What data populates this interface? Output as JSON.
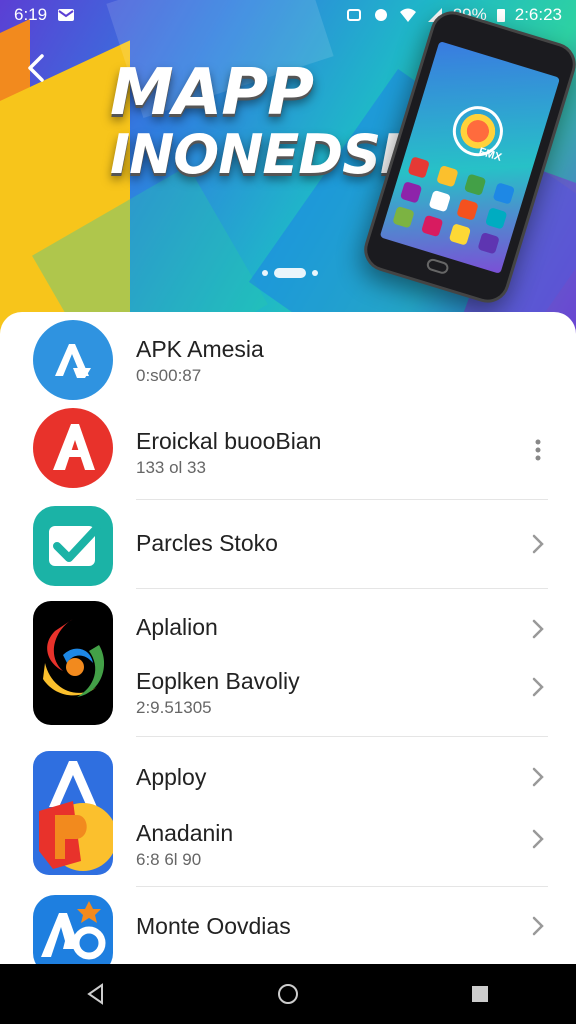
{
  "status_bar": {
    "time_left": "6:19",
    "battery": "89%",
    "time_right": "2:6:23"
  },
  "hero": {
    "title_line1": "MAPP",
    "title_line2": "INONEDSI",
    "phone_badge": "FMX"
  },
  "apps": [
    {
      "title": "APK Amesia",
      "subtitle": "0:s00:87",
      "icon": "apk-app-icon"
    },
    {
      "title": "Eroickal buooBian",
      "subtitle": "133 ol 33",
      "icon": "red-a-app-icon"
    },
    {
      "title": "Parcles Stoko",
      "subtitle": "",
      "icon": "checkmark-app-icon"
    },
    {
      "title": "Aplalion",
      "subtitle": "",
      "icon": "swirl-app-icon"
    },
    {
      "title": "Eoplken Bavoliy",
      "subtitle": "2:9.51305",
      "icon": ""
    },
    {
      "title": "Apploy",
      "subtitle": "",
      "icon": "blue-a-app-icon"
    },
    {
      "title": "Anadanin",
      "subtitle": "6:8 6l 90",
      "icon": ""
    },
    {
      "title": "Monte Oovdias",
      "subtitle": "",
      "icon": "ao-app-icon"
    }
  ],
  "colors": {
    "accent_blue": "#2f8fe0",
    "apk_red": "#e8322b",
    "teal": "#1bb3a6"
  }
}
